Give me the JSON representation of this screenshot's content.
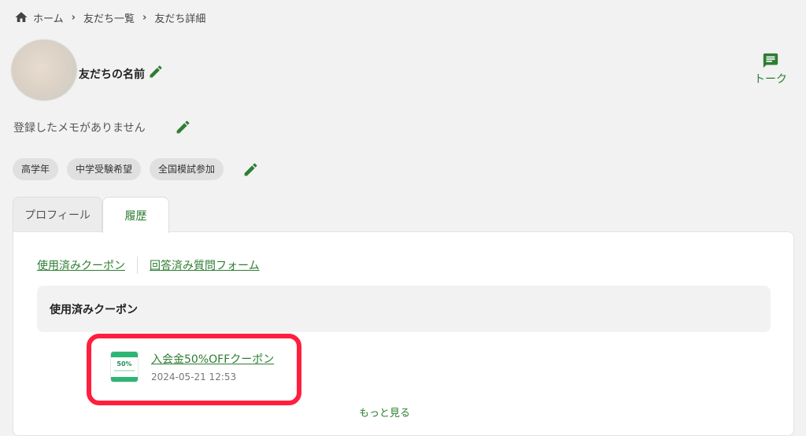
{
  "breadcrumb": {
    "home": "ホーム",
    "friends_list": "友だち一覧",
    "current": "友だち詳細"
  },
  "friend": {
    "name": "友だちの名前"
  },
  "talk": {
    "label": "トーク"
  },
  "memo": {
    "empty_text": "登録したメモがありません"
  },
  "tags": [
    "高学年",
    "中学受験希望",
    "全国模試参加"
  ],
  "tabs": [
    {
      "label": "プロフィール",
      "active": false
    },
    {
      "label": "履歴",
      "active": true
    }
  ],
  "history": {
    "links": [
      "使用済みクーポン",
      "回答済み質問フォーム"
    ],
    "section_title": "使用済みクーポン",
    "coupons": [
      {
        "thumb_text": "50%",
        "title": "入会金50%OFFクーポン",
        "datetime": "2024-05-21 12:53"
      }
    ],
    "more_label": "もっと見る"
  },
  "colors": {
    "accent": "#2e7d32",
    "highlight": "#ff1f3d",
    "background": "#f2f2f2"
  }
}
